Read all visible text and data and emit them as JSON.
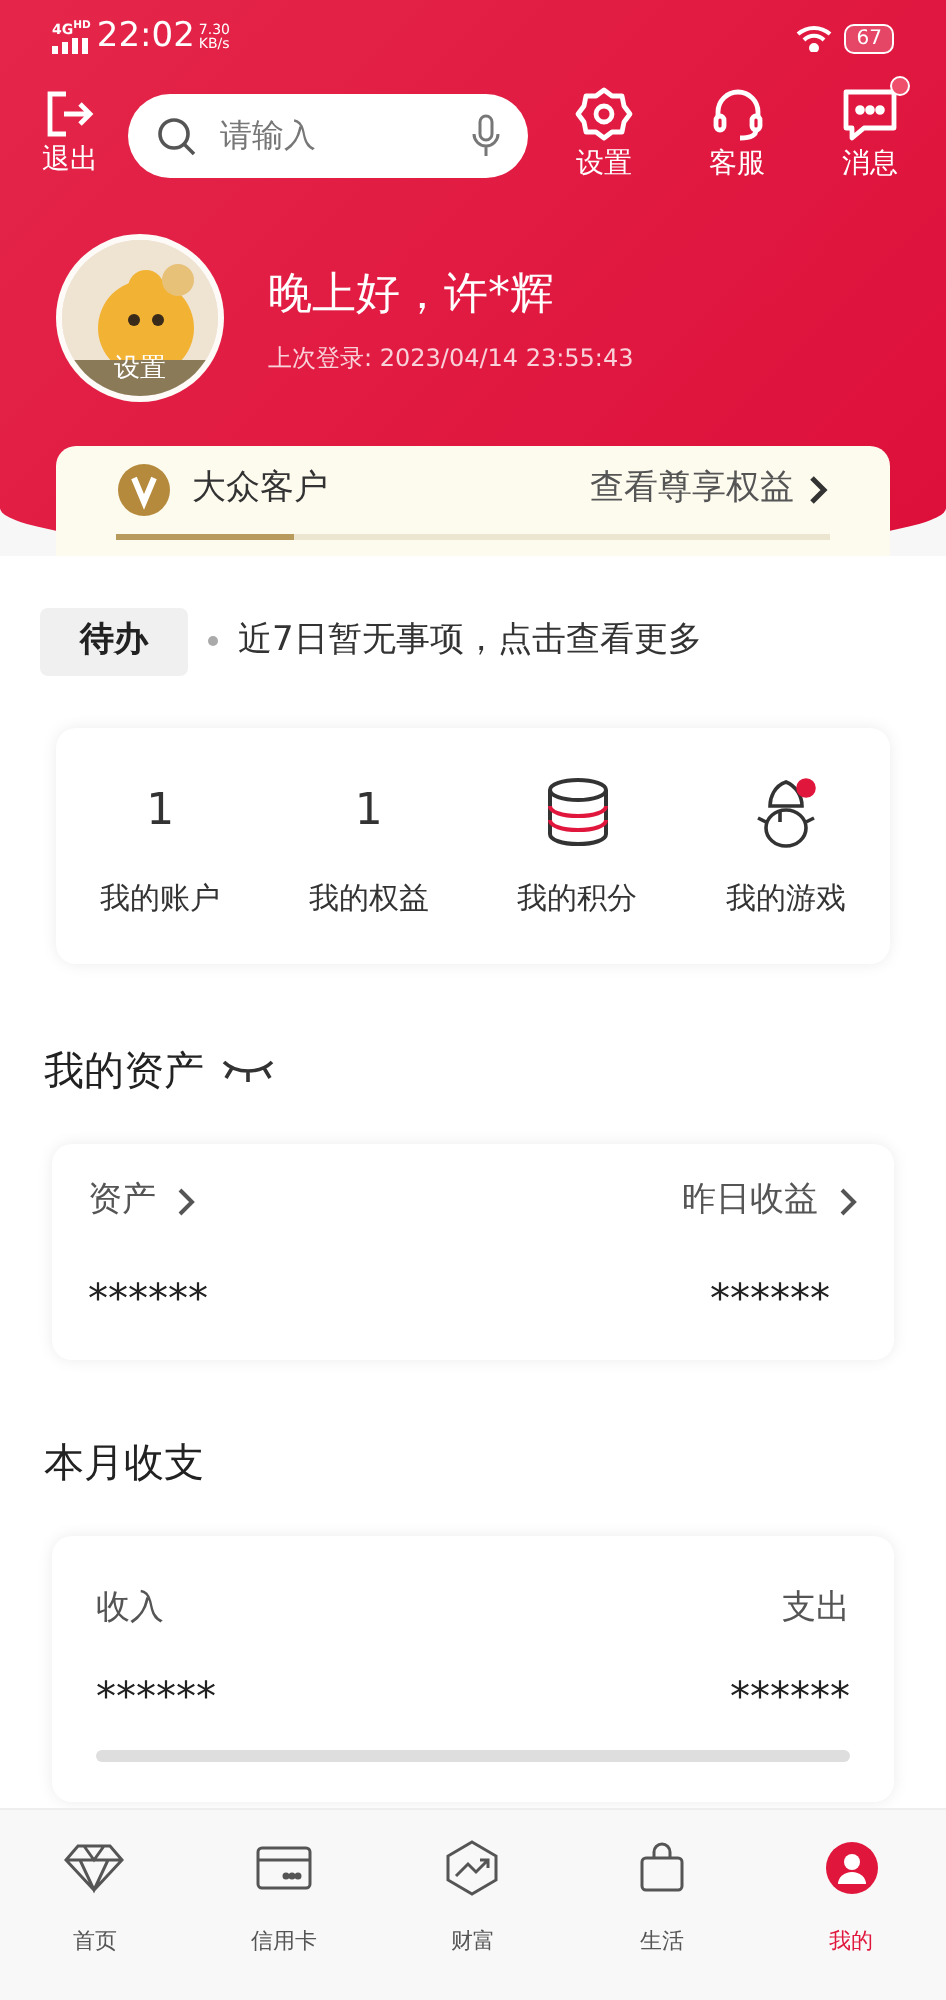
{
  "status_bar": {
    "network": "4G",
    "network_sub": "HD",
    "time": "22:02",
    "speed": "7.30",
    "speed_unit": "KB/s",
    "battery": "67"
  },
  "top_bar": {
    "logout": "退出",
    "search": {
      "placeholder": "请输入"
    },
    "actions": [
      {
        "kind": "settings",
        "label": "设置",
        "badge": false
      },
      {
        "kind": "service",
        "label": "客服",
        "badge": false
      },
      {
        "kind": "messages",
        "label": "消息",
        "badge": true
      }
    ]
  },
  "profile": {
    "avatar_label": "设置",
    "greeting": "晚上好，许*辉",
    "last_login": "上次登录: 2023/04/14 23:55:43"
  },
  "membership": {
    "level_name": "大众客户",
    "link": "查看尊享权益",
    "level": 0.25
  },
  "todo": {
    "tag": "待办",
    "text": "近7日暂无事项，点击查看更多"
  },
  "shortcuts": [
    {
      "kind": "number",
      "value": "1",
      "label": "我的账户"
    },
    {
      "kind": "number",
      "value": "1",
      "label": "我的权益"
    },
    {
      "kind": "points",
      "label": "我的积分"
    },
    {
      "kind": "game",
      "label": "我的游戏"
    }
  ],
  "assets": {
    "title": "我的资产",
    "left_label": "资产",
    "left_value": "******",
    "right_label": "昨日收益",
    "right_value": "******"
  },
  "monthly": {
    "title": "本月收支",
    "income_label": "收入",
    "income_value": "******",
    "expense_label": "支出",
    "expense_value": "******"
  },
  "tab_bar": [
    {
      "kind": "home",
      "label": "首页",
      "selected": false
    },
    {
      "kind": "card",
      "label": "信用卡",
      "selected": false
    },
    {
      "kind": "wealth",
      "label": "财富",
      "selected": false
    },
    {
      "kind": "life",
      "label": "生活",
      "selected": false
    },
    {
      "kind": "mine",
      "label": "我的",
      "selected": true
    }
  ]
}
